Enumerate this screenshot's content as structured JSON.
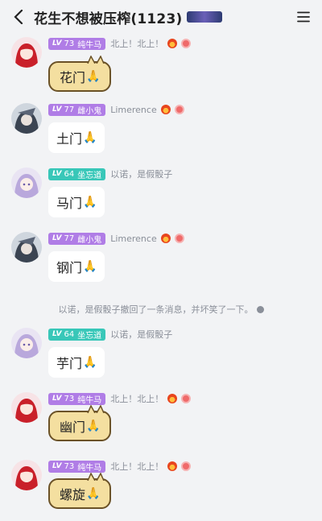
{
  "header": {
    "title": "花生不想被压榨(1123)",
    "menu_icon": "hamburger-icon",
    "back_icon": "chevron-left-icon"
  },
  "messages": [
    {
      "user_level": "73",
      "user_name": "纯牛马",
      "status": "北上！北上！",
      "text": "花门",
      "emoji": "🙏",
      "style": "cat"
    },
    {
      "user_level": "77",
      "user_name": "雌小鬼",
      "status": "Limerence",
      "text": "土门",
      "emoji": "🙏",
      "style": "plain"
    },
    {
      "user_level": "64",
      "user_name": "坐忘道",
      "status": "以诺，是假骰子",
      "text": "马门",
      "emoji": "🙏",
      "style": "plain"
    },
    {
      "user_level": "77",
      "user_name": "雌小鬼",
      "status": "Limerence",
      "text": "钢门",
      "emoji": "🙏",
      "style": "plain"
    },
    {
      "user_level": "64",
      "user_name": "坐忘道",
      "status": "以诺，是假骰子",
      "text": "芋门",
      "emoji": "🙏",
      "style": "plain"
    },
    {
      "user_level": "73",
      "user_name": "纯牛马",
      "status": "北上！北上！",
      "text": "幽门",
      "emoji": "🙏",
      "style": "cat"
    },
    {
      "user_level": "73",
      "user_name": "纯牛马",
      "status": "北上！北上！",
      "text": "螺旋",
      "emoji": "🙏",
      "style": "cat"
    }
  ],
  "system_notice": "以诺，是假骰子撤回了一条消息，并坏笑了一下。",
  "lv_prefix": "LV",
  "colors": {
    "background": "#f2f3f5",
    "level_purple": "#b07de6",
    "level_teal": "#38c7b8",
    "cat_bubble": "#f4dfa0"
  }
}
